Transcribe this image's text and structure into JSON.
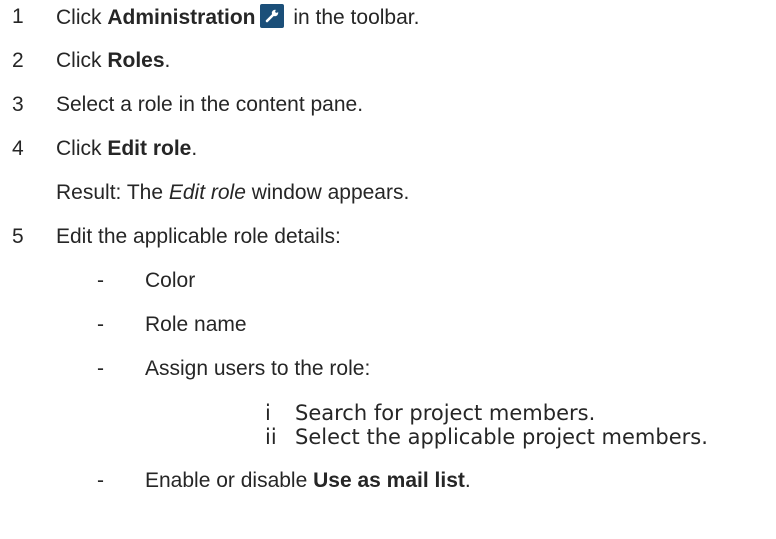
{
  "steps": [
    {
      "num": "1",
      "pre": "Click ",
      "bold": "Administration",
      "post": " in the toolbar.",
      "icon": "wrench-icon"
    },
    {
      "num": "2",
      "pre": "Click ",
      "bold": "Roles",
      "post": "."
    },
    {
      "num": "3",
      "text": "Select a role in the content pane."
    },
    {
      "num": "4",
      "pre": "Click ",
      "bold": "Edit role",
      "post": "."
    },
    {
      "result_pre": "Result: The ",
      "result_em": "Edit role",
      "result_post": " window appears."
    },
    {
      "num": "5",
      "text": "Edit the applicable role details:"
    }
  ],
  "details": [
    {
      "dash": "-",
      "text": "Color"
    },
    {
      "dash": "-",
      "text": "Role name"
    },
    {
      "dash": "-",
      "text": "Assign users to the role:"
    },
    {
      "dash": "-",
      "pre": "Enable or disable ",
      "bold": "Use as mail list",
      "post": "."
    }
  ],
  "substeps": [
    {
      "num": "i",
      "text": "Search for project members."
    },
    {
      "num": "ii",
      "text": "Select the applicable project members."
    }
  ],
  "colors": {
    "text": "#262626",
    "icon_bg": "#1b4f79"
  }
}
